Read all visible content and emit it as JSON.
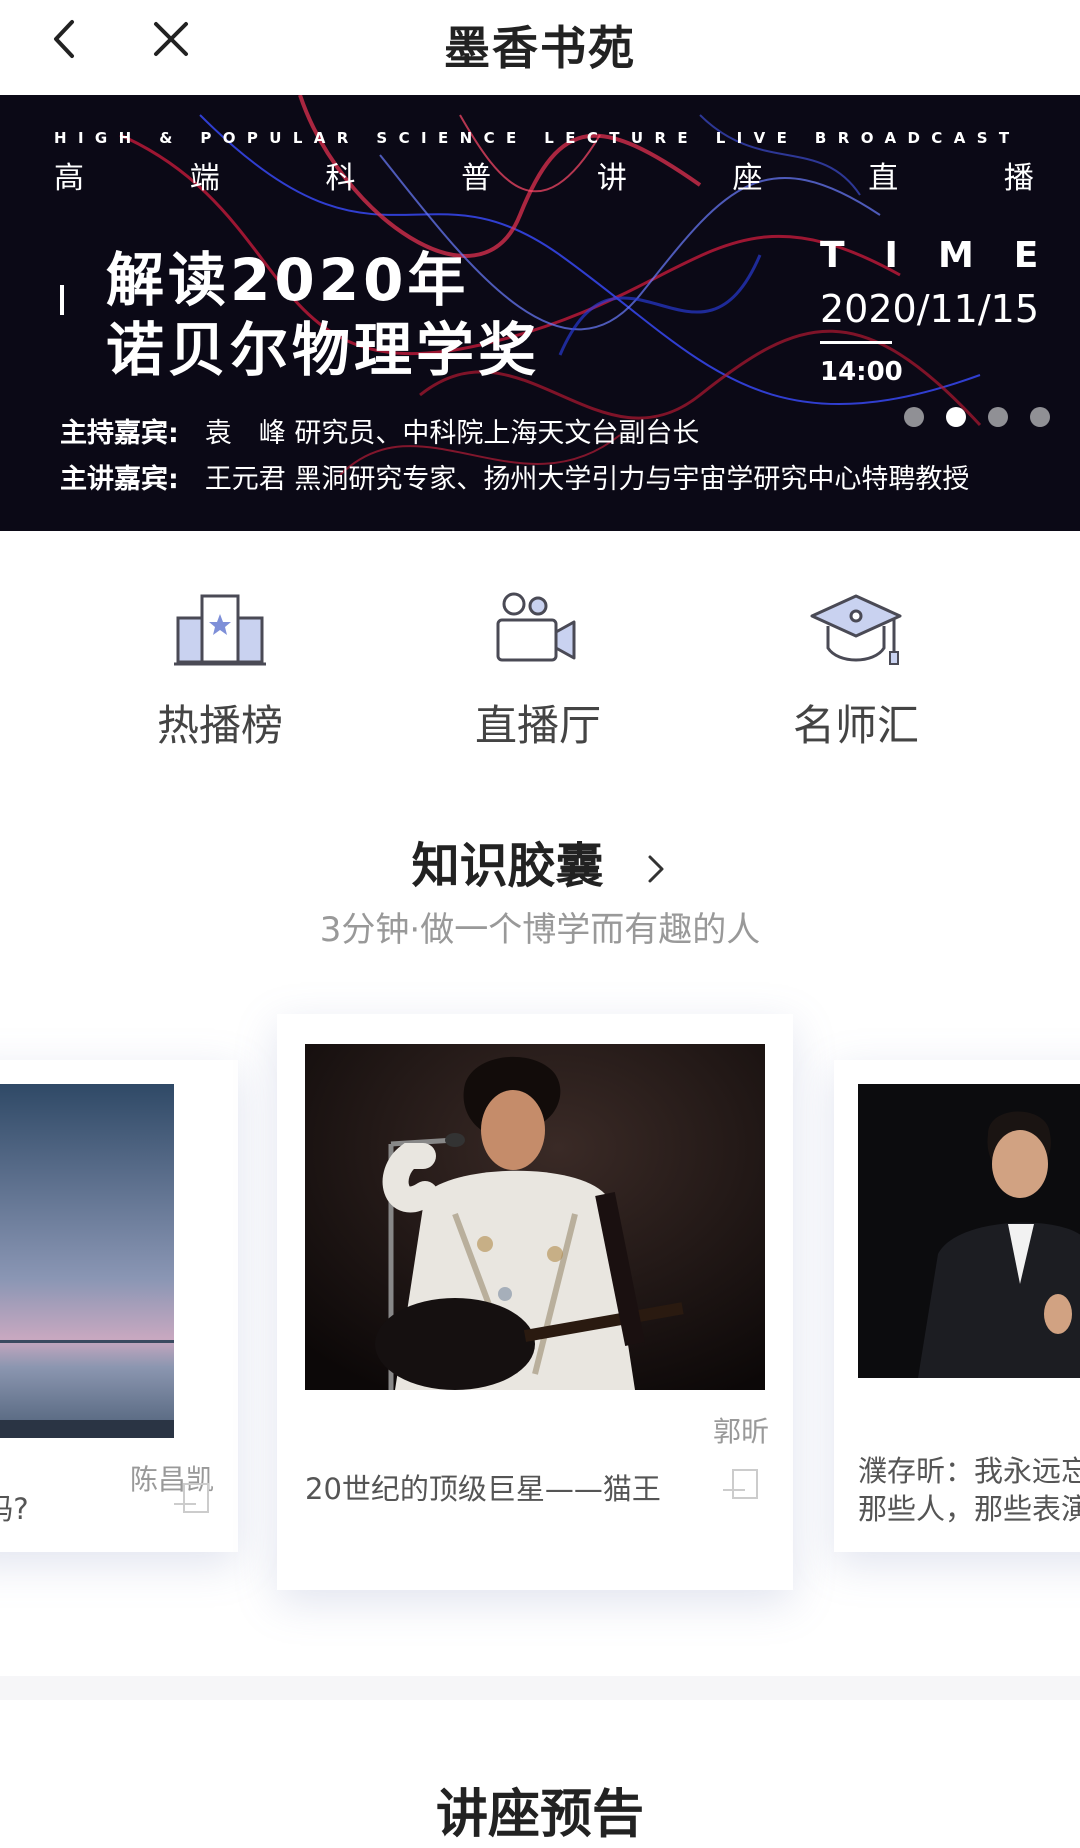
{
  "nav": {
    "title": "墨香书苑"
  },
  "banner": {
    "english_line": "HIGH & POPULAR SCIENCE LECTURE LIVE BROADCAST",
    "chinese_chars": [
      "高",
      "端",
      "科",
      "普",
      "讲",
      "座",
      "直",
      "播"
    ],
    "title_line1": "解读2020年",
    "title_line2": "诺贝尔物理学奖",
    "time_label": "TIME",
    "date": "2020/11/15",
    "hour": "14:00",
    "host_label": "主持嘉宾:",
    "host_text": "袁　峰  研究员、中科院上海天文台副台长",
    "speaker_label": "主讲嘉宾:",
    "speaker_text": "王元君  黑洞研究专家、扬州大学引力与宇宙学研究中心特聘教授",
    "slide_count": 4,
    "active_slide": 2
  },
  "categories": [
    {
      "label": "热播榜",
      "icon": "ranking-podium-icon"
    },
    {
      "label": "直播厅",
      "icon": "video-camera-icon"
    },
    {
      "label": "名师汇",
      "icon": "graduation-cap-icon"
    }
  ],
  "capsule": {
    "title": "知识胶囊",
    "subtitle": "3分钟·做一个博学而有趣的人"
  },
  "cards": [
    {
      "author": "陈昌凯",
      "title": "” 吗?",
      "image": "sea-horizon-photo"
    },
    {
      "author": "郭昕",
      "title": "20世纪的顶级巨星——猫王",
      "image": "singer-with-guitar-photo"
    },
    {
      "title_line1": "濮存昕：我永远忘",
      "title_line2": "那些人，那些表演",
      "image": "actor-in-suit-photo"
    }
  ],
  "lecture": {
    "title": "讲座预告"
  }
}
